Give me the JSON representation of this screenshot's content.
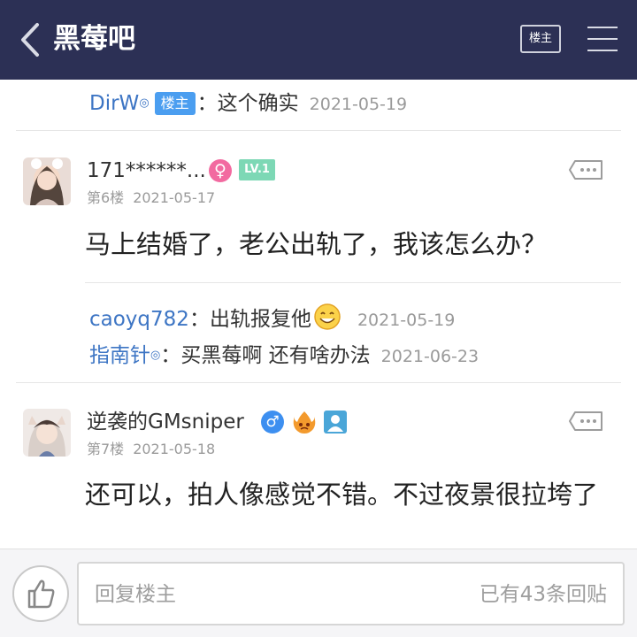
{
  "header": {
    "title": "黑莓吧",
    "louzhu_label": "楼主"
  },
  "top_reply": {
    "user": "DirW",
    "badge": "楼主",
    "text": "：这个确实",
    "date": "2021-05-19"
  },
  "posts": [
    {
      "username": "171******...",
      "gender": "♀",
      "level": "LV.1",
      "floor": "第6楼",
      "date": "2021-05-17",
      "content": "马上结婚了，老公出轨了，我该怎么办？",
      "replies": [
        {
          "user": "caoyq782",
          "text": "：出轨报复他",
          "emoji": "smile-emoji",
          "date": "2021-05-19"
        },
        {
          "user": "指南针",
          "text": "：买黑莓啊 还有啥办法",
          "date": "2021-06-23"
        }
      ]
    },
    {
      "username": "逆袭的GMsniper",
      "gender": "♂",
      "floor": "第7楼",
      "date": "2021-05-18",
      "content": "还可以，拍人像感觉不错。不过夜景很拉垮了"
    }
  ],
  "bottom_bar": {
    "reply_placeholder": "回复楼主",
    "reply_count": "已有43条回贴"
  },
  "colors": {
    "header_bg": "#2c3055",
    "link_blue": "#3d75c4",
    "badge_blue": "#4b9ef0",
    "level_green": "#7dd8b5",
    "female_pink": "#f26aa0"
  }
}
